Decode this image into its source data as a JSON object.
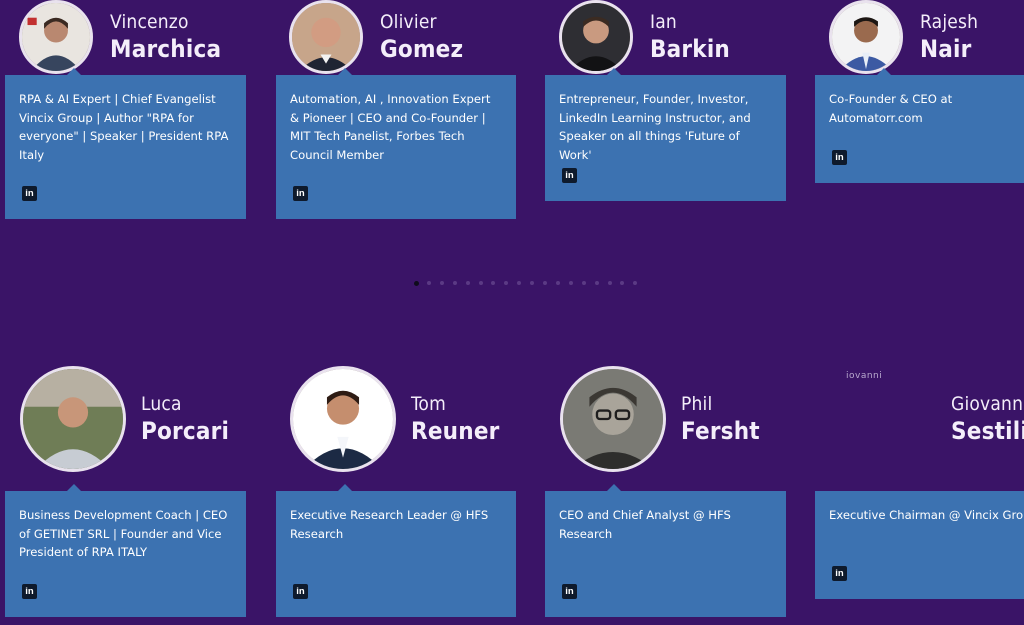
{
  "people": [
    {
      "first": "Vincenzo",
      "last": "Marchica",
      "bio": "RPA & AI Expert | Chief Evangelist Vincix Group | Author \"RPA for everyone\" | Speaker | President RPA Italy",
      "linkedin": "in"
    },
    {
      "first": "Olivier",
      "last": "Gomez",
      "bio": "Automation, AI , Innovation Expert & Pioneer | CEO and Co-Founder | MIT Tech Panelist, Forbes Tech Council Member",
      "linkedin": "in"
    },
    {
      "first": "Ian",
      "last": "Barkin",
      "bio": "Entrepreneur, Founder, Investor, LinkedIn Learning Instructor, and Speaker on all things 'Future of Work'",
      "linkedin": "in"
    },
    {
      "first": "Rajesh",
      "last": "Nair",
      "bio": "Co-Founder & CEO at Automatorr.com",
      "linkedin": "in"
    },
    {
      "first": "Luca",
      "last": "Porcari",
      "bio": "Business Development Coach | CEO of GETINET SRL | Founder and Vice President of RPA ITALY",
      "linkedin": "in"
    },
    {
      "first": "Tom",
      "last": "Reuner",
      "bio": "Executive Research Leader @ HFS Research",
      "linkedin": "in"
    },
    {
      "first": "Phil",
      "last": "Fersht",
      "bio": "CEO and Chief Analyst @ HFS Research",
      "linkedin": "in"
    },
    {
      "first": "Giovanni",
      "last": "Sestili",
      "bio": "Executive Chairman @ Vincix Group",
      "linkedin": "in",
      "image_alt": "iovanni"
    }
  ],
  "pagination": {
    "total": 18,
    "active": 0
  },
  "colors": {
    "background": "#3a1467",
    "card": "#3c72b1",
    "text": "#ffffff"
  }
}
